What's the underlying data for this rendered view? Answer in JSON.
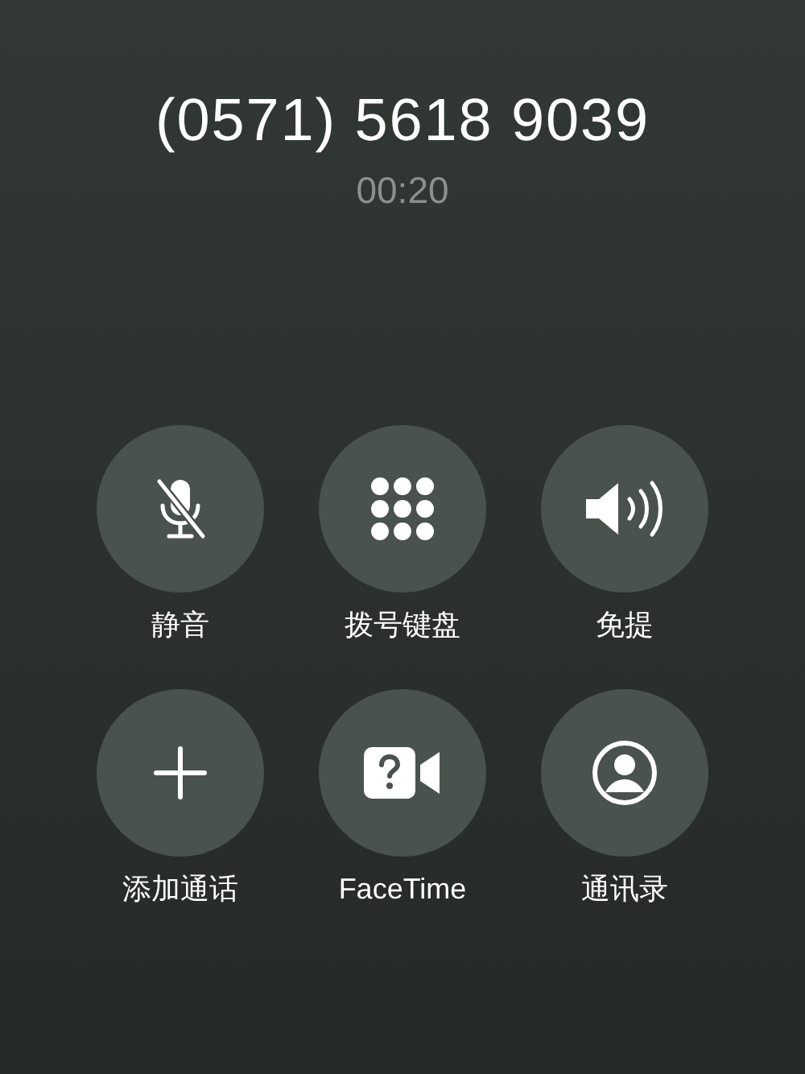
{
  "call": {
    "number": "(0571) 5618 9039",
    "duration": "00:20"
  },
  "buttons": [
    {
      "kind": "mute",
      "label": "静音"
    },
    {
      "kind": "keypad",
      "label": "拨号键盘"
    },
    {
      "kind": "speaker",
      "label": "免提"
    },
    {
      "kind": "add",
      "label": "添加通话"
    },
    {
      "kind": "facetime",
      "label": "FaceTime"
    },
    {
      "kind": "contacts",
      "label": "通讯录"
    }
  ]
}
